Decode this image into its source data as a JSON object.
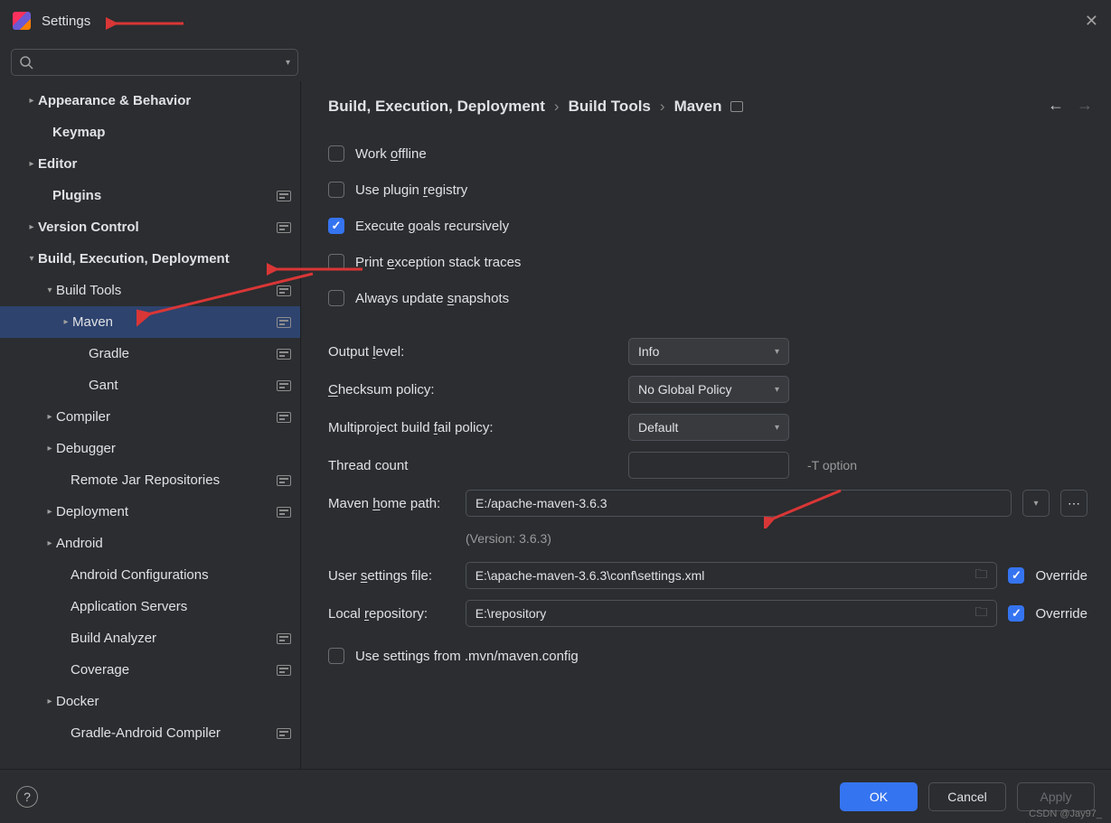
{
  "window": {
    "title": "Settings"
  },
  "sidebar": {
    "items": [
      {
        "label": "Appearance & Behavior",
        "chev": "right",
        "bold": true,
        "indent": 28
      },
      {
        "label": "Keymap",
        "chev": "",
        "bold": true,
        "indent": 44
      },
      {
        "label": "Editor",
        "chev": "right",
        "bold": true,
        "indent": 28
      },
      {
        "label": "Plugins",
        "chev": "",
        "bold": true,
        "indent": 44,
        "badge": true
      },
      {
        "label": "Version Control",
        "chev": "right",
        "bold": true,
        "indent": 28,
        "badge": true
      },
      {
        "label": "Build, Execution, Deployment",
        "chev": "down",
        "bold": true,
        "indent": 28
      },
      {
        "label": "Build Tools",
        "chev": "down",
        "bold": false,
        "indent": 48,
        "badge": true
      },
      {
        "label": "Maven",
        "chev": "right",
        "bold": false,
        "indent": 66,
        "badge": true,
        "selected": true
      },
      {
        "label": "Gradle",
        "chev": "",
        "bold": false,
        "indent": 84,
        "badge": true
      },
      {
        "label": "Gant",
        "chev": "",
        "bold": false,
        "indent": 84,
        "badge": true
      },
      {
        "label": "Compiler",
        "chev": "right",
        "bold": false,
        "indent": 48,
        "badge": true
      },
      {
        "label": "Debugger",
        "chev": "right",
        "bold": false,
        "indent": 48
      },
      {
        "label": "Remote Jar Repositories",
        "chev": "",
        "bold": false,
        "indent": 64,
        "badge": true
      },
      {
        "label": "Deployment",
        "chev": "right",
        "bold": false,
        "indent": 48,
        "badge": true
      },
      {
        "label": "Android",
        "chev": "right",
        "bold": false,
        "indent": 48
      },
      {
        "label": "Android Configurations",
        "chev": "",
        "bold": false,
        "indent": 64
      },
      {
        "label": "Application Servers",
        "chev": "",
        "bold": false,
        "indent": 64
      },
      {
        "label": "Build Analyzer",
        "chev": "",
        "bold": false,
        "indent": 64,
        "badge": true
      },
      {
        "label": "Coverage",
        "chev": "",
        "bold": false,
        "indent": 64,
        "badge": true
      },
      {
        "label": "Docker",
        "chev": "right",
        "bold": false,
        "indent": 48
      },
      {
        "label": "Gradle-Android Compiler",
        "chev": "",
        "bold": false,
        "indent": 64,
        "badge": true
      }
    ]
  },
  "breadcrumbs": {
    "a": "Build, Execution, Deployment",
    "b": "Build Tools",
    "c": "Maven"
  },
  "checks": {
    "work_offline_pre": "Work ",
    "work_offline_u": "o",
    "work_offline_post": "ffline",
    "plugin_registry_pre": "Use plugin ",
    "plugin_registry_u": "r",
    "plugin_registry_post": "egistry",
    "execute_pre": "Execute ",
    "execute_u": "g",
    "execute_post": "oals recursively",
    "print_ex_pre": "Print ",
    "print_ex_u": "e",
    "print_ex_post": "xception stack traces",
    "snapshots_pre": "Always update ",
    "snapshots_u": "s",
    "snapshots_post": "napshots",
    "mvn_config": "Use settings from .mvn/maven.config"
  },
  "labels": {
    "output_level_pre": "Output ",
    "output_level_u": "l",
    "output_level_post": "evel:",
    "checksum_pre": "",
    "checksum_u": "C",
    "checksum_post": "hecksum policy:",
    "multiproject_pre": "Multiproject build ",
    "multiproject_u": "f",
    "multiproject_post": "ail policy:",
    "thread_count": "Thread count",
    "maven_home_pre": "Maven ",
    "maven_home_u": "h",
    "maven_home_post": "ome path:",
    "user_settings_pre": "User ",
    "user_settings_u": "s",
    "user_settings_post": "ettings file:",
    "local_repo_pre": "Local ",
    "local_repo_u": "r",
    "local_repo_post": "epository:",
    "thread_hint": "-T option",
    "version_note": "(Version: 3.6.3)",
    "override": "Override"
  },
  "values": {
    "output_level": "Info",
    "checksum": "No Global Policy",
    "multiproject": "Default",
    "thread_count": "",
    "maven_home": "E:/apache-maven-3.6.3",
    "user_settings": "E:\\apache-maven-3.6.3\\conf\\settings.xml",
    "local_repo": "E:\\repository"
  },
  "buttons": {
    "ok": "OK",
    "cancel": "Cancel",
    "apply": "Apply"
  },
  "watermark": "CSDN @Jay97_"
}
